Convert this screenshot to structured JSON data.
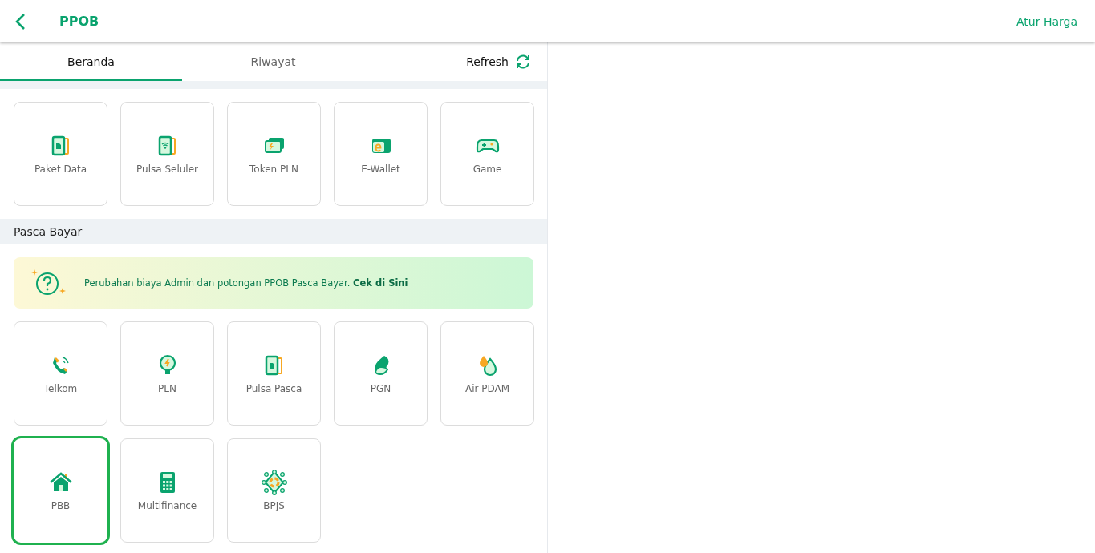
{
  "header": {
    "title": "PPOB",
    "action": "Atur Harga"
  },
  "tabs": [
    {
      "label": "Beranda",
      "selected": true
    },
    {
      "label": "Riwayat",
      "selected": false
    }
  ],
  "refresh": {
    "label": "Refresh"
  },
  "prabayar": {
    "items": [
      {
        "label": "Paket Data",
        "selected": false
      },
      {
        "label": "Pulsa Seluler",
        "selected": false
      },
      {
        "label": "Token PLN",
        "selected": false
      },
      {
        "label": "E-Wallet",
        "selected": false
      },
      {
        "label": "Game",
        "selected": false
      }
    ]
  },
  "pascabayar": {
    "title": "Pasca Bayar",
    "banner": "Perubahan biaya Admin dan potongan PPOB Pasca Bayar. **Cek di Sini**",
    "items": [
      {
        "label": "Telkom",
        "selected": false
      },
      {
        "label": "PLN",
        "selected": false
      },
      {
        "label": "Pulsa Pasca",
        "selected": false
      },
      {
        "label": "PGN",
        "selected": false
      },
      {
        "label": "Air PDAM",
        "selected": false
      },
      {
        "label": "PBB",
        "selected": true
      },
      {
        "label": "Multifinance",
        "selected": false
      },
      {
        "label": "BPJS",
        "selected": false
      }
    ]
  }
}
